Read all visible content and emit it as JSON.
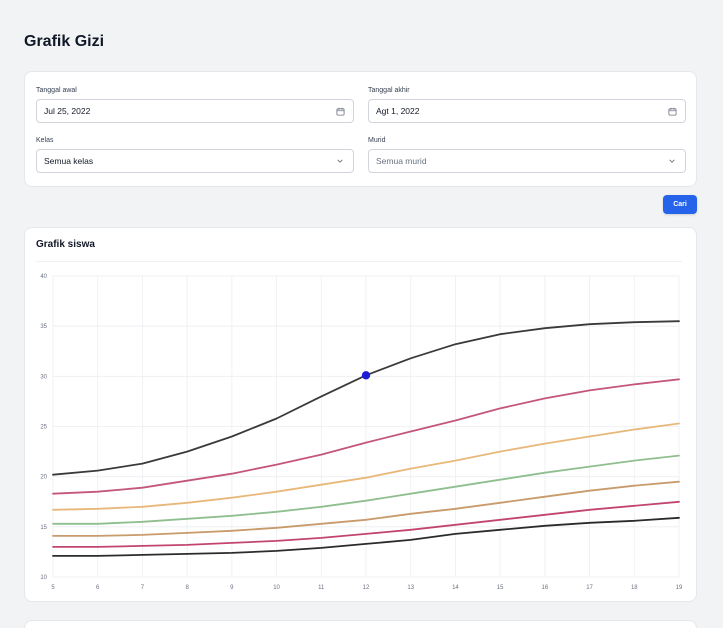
{
  "page": {
    "title": "Grafik Gizi"
  },
  "filters": {
    "start_date": {
      "label": "Tanggal awal",
      "value": "Jul 25, 2022"
    },
    "end_date": {
      "label": "Tanggal akhir",
      "value": "Agt 1, 2022"
    },
    "class": {
      "label": "Kelas",
      "value": "Semua kelas"
    },
    "student": {
      "label": "Murid",
      "placeholder": "Semua murid"
    },
    "search_label": "Cari"
  },
  "chart": {
    "title": "Grafik siswa",
    "point_color": "#1d1dd6"
  },
  "chart_data": {
    "type": "line",
    "title": "Grafik siswa",
    "xlabel": "",
    "ylabel": "",
    "xlim": [
      5,
      19
    ],
    "ylim": [
      10,
      40
    ],
    "xticks": [
      5,
      6,
      7,
      8,
      9,
      10,
      11,
      12,
      13,
      14,
      15,
      16,
      17,
      18,
      19
    ],
    "yticks": [
      10,
      15,
      20,
      25,
      30,
      35,
      40
    ],
    "grid": true,
    "legend": "none",
    "x": [
      5,
      6,
      7,
      8,
      9,
      10,
      11,
      12,
      13,
      14,
      15,
      16,
      17,
      18,
      19
    ],
    "series": [
      {
        "color": "#3a3a3a",
        "values": [
          20.2,
          20.6,
          21.3,
          22.5,
          24.0,
          25.8,
          28.0,
          30.1,
          31.8,
          33.2,
          34.2,
          34.8,
          35.2,
          35.4,
          35.5
        ]
      },
      {
        "color": "#c4567a",
        "values": [
          18.3,
          18.5,
          18.9,
          19.6,
          20.3,
          21.2,
          22.2,
          23.4,
          24.5,
          25.6,
          26.8,
          27.8,
          28.6,
          29.2,
          29.7
        ]
      },
      {
        "color": "#e8b87a",
        "values": [
          16.7,
          16.8,
          17.0,
          17.4,
          17.9,
          18.5,
          19.2,
          19.9,
          20.8,
          21.6,
          22.5,
          23.3,
          24.0,
          24.7,
          25.3
        ]
      },
      {
        "color": "#8fbf8f",
        "values": [
          15.3,
          15.3,
          15.5,
          15.8,
          16.1,
          16.5,
          17.0,
          17.6,
          18.3,
          19.0,
          19.7,
          20.4,
          21.0,
          21.6,
          22.1
        ]
      },
      {
        "color": "#c99a6a",
        "values": [
          14.1,
          14.1,
          14.2,
          14.4,
          14.6,
          14.9,
          15.3,
          15.7,
          16.3,
          16.8,
          17.4,
          18.0,
          18.6,
          19.1,
          19.5
        ]
      },
      {
        "color": "#c2456f",
        "values": [
          13.0,
          13.0,
          13.1,
          13.2,
          13.4,
          13.6,
          13.9,
          14.3,
          14.7,
          15.2,
          15.7,
          16.2,
          16.7,
          17.1,
          17.5
        ]
      },
      {
        "color": "#2b2b2b",
        "values": [
          12.1,
          12.1,
          12.2,
          12.3,
          12.4,
          12.6,
          12.9,
          13.3,
          13.7,
          14.3,
          14.7,
          15.1,
          15.4,
          15.6,
          15.9
        ]
      }
    ],
    "highlight_point": {
      "series_index": 0,
      "x": 12,
      "y": 30.1
    }
  }
}
